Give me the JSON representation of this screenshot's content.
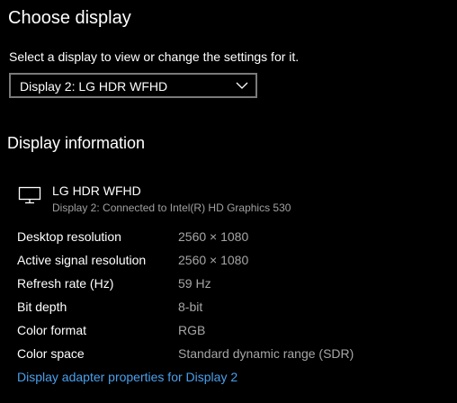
{
  "page": {
    "title": "Choose display",
    "subtitle": "Select a display to view or change the settings for it."
  },
  "display_select": {
    "value": "Display 2: LG HDR WFHD",
    "icon": "chevron-down-icon"
  },
  "display_info": {
    "heading": "Display information",
    "icon": "monitor-icon",
    "name": "LG HDR WFHD",
    "connection": "Display 2: Connected to Intel(R) HD Graphics 530",
    "rows": [
      {
        "label": "Desktop resolution",
        "value": "2560 × 1080"
      },
      {
        "label": "Active signal resolution",
        "value": "2560 × 1080"
      },
      {
        "label": "Refresh rate (Hz)",
        "value": "59 Hz"
      },
      {
        "label": "Bit depth",
        "value": "8-bit"
      },
      {
        "label": "Color format",
        "value": "RGB"
      },
      {
        "label": "Color space",
        "value": "Standard dynamic range (SDR)"
      }
    ],
    "adapter_link": "Display adapter properties for Display 2"
  },
  "colors": {
    "background": "#000000",
    "text": "#ffffff",
    "secondary_text": "#a6a6a6",
    "link": "#4aa0ec",
    "select_border": "#7a7a7a"
  }
}
